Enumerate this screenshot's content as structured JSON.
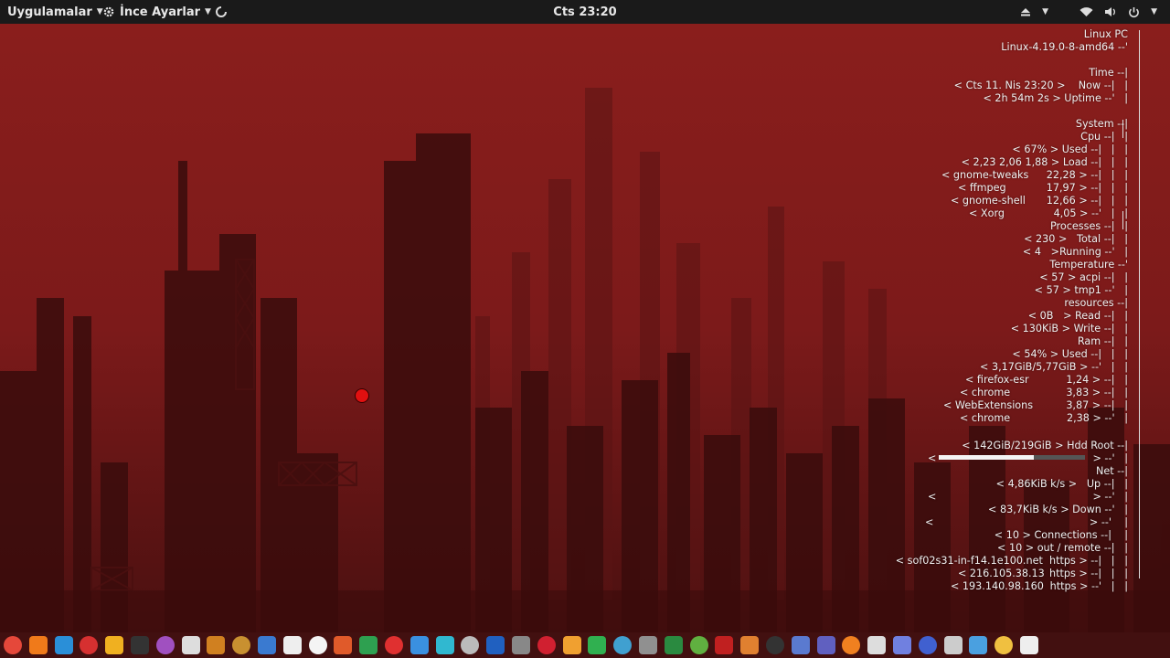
{
  "topbar": {
    "apps_label": "Uygulamalar",
    "tweaks_label": "İnce Ayarlar",
    "clock": "Cts 23:20"
  },
  "conky": {
    "host": "Linux PC",
    "kernel": "Linux-4.19.0-8-amd64",
    "time_header": "Time",
    "now_value": "< Cts 11. Nis 23:20 >",
    "now_label": "Now",
    "uptime_value": "< 2h 54m 2s >",
    "uptime_label": "Uptime",
    "system_header": "System",
    "cpu_header": "Cpu",
    "cpu_used_value": "< 67% >",
    "cpu_used_label": "Used",
    "load_value": "< 2,23 2,06 1,88 >",
    "load_label": "Load",
    "cpu_top": [
      {
        "name": "< gnome-tweaks",
        "value": "22,28 >"
      },
      {
        "name": "< ffmpeg",
        "value": "17,97 >"
      },
      {
        "name": "< gnome-shell",
        "value": "12,66 >"
      },
      {
        "name": "< Xorg",
        "value": "4,05 >"
      }
    ],
    "processes_header": "Processes",
    "total_value": "< 230 >",
    "total_label": "Total",
    "running_value": "< 4   >",
    "running_label": "Running",
    "temperature_header": "Temperature",
    "acpi_value": "< 57 >",
    "acpi_label": "acpi",
    "tmp1_value": "< 57 >",
    "tmp1_label": "tmp1",
    "resources_header": "resources",
    "read_value": "< 0B   >",
    "read_label": "Read",
    "write_value": "< 130KiB >",
    "write_label": "Write",
    "ram_header": "Ram",
    "ram_used_value": "< 54% >",
    "ram_used_label": "Used",
    "ram_amount": "< 3,17GiB/5,77GiB >",
    "mem_top": [
      {
        "name": "< firefox-esr",
        "value": "1,24 >"
      },
      {
        "name": "< chrome",
        "value": "3,83 >"
      },
      {
        "name": "< WebExtensions",
        "value": "3,87 >"
      },
      {
        "name": "< chrome",
        "value": "2,38 >"
      }
    ],
    "hdd_value": "< 142GiB/219GiB >",
    "hdd_label": "Hdd Root",
    "hdd_fraction": 0.65,
    "net_header": "Net",
    "up_value": "< 4,86KiB k/s >",
    "up_label": "Up",
    "down_value": "< 83,7KiB k/s >",
    "down_label": "Down",
    "connections_value": "< 10 >",
    "connections_label": "Connections",
    "outremote_value": "< 10 >",
    "outremote_label": "out / remote",
    "remotes": [
      {
        "host": "< sof02s31-in-f14.1e100.net",
        "port": "https >"
      },
      {
        "host": "< 216.105.38.13",
        "port": "https >"
      },
      {
        "host": "< 193.140.98.160",
        "port": "https >"
      }
    ]
  },
  "dock": {
    "icons": [
      "chrome-icon",
      "firefox-icon",
      "browser-icon",
      "opera-icon",
      "files-icon",
      "terminal-icon",
      "media-player-icon",
      "soccer-icon",
      "cleaner-icon",
      "broom-icon",
      "display-icon",
      "document-icon",
      "text-editor-icon",
      "presentation-icon",
      "spreadsheet-icon",
      "text-t-icon",
      "chromium-icon",
      "play-store-icon",
      "grid-app-icon",
      "calculator-icon",
      "settings-icon",
      "ad-blocker-icon",
      "pinwheel-icon",
      "spotify-icon",
      "screenshot-icon",
      "disk-icon",
      "system-monitor-icon",
      "archive-icon",
      "recorder-icon",
      "paint-icon",
      "steam-icon",
      "screen-icon",
      "teams-icon",
      "vlc-icon",
      "bluetooth-icon",
      "discord-icon",
      "activity-monitor-icon",
      "trash-icon",
      "window-icon",
      "weather-icon",
      "clock-icon"
    ],
    "colors": [
      "#e5483a",
      "#f07a1a",
      "#2a8fd8",
      "#d63030",
      "#f0b020",
      "#333333",
      "#a050c0",
      "#dddddd",
      "#d08020",
      "#c89030",
      "#3a7ad0",
      "#eeeeee",
      "#f4f4f4",
      "#e05a2a",
      "#2ea050",
      "#e03030",
      "#3a90e0",
      "#30b8d0",
      "#bbbbbb",
      "#2060c0",
      "#888888",
      "#d02030",
      "#f0a030",
      "#30b050",
      "#40a0d0",
      "#909090",
      "#2a8a40",
      "#60b040",
      "#c02020",
      "#e08030",
      "#333333",
      "#5a7ad0",
      "#6060c0",
      "#f08020",
      "#dddddd",
      "#7080e0",
      "#4060d0",
      "#cccccc",
      "#4aa0e0",
      "#f0c040",
      "#eeeeee"
    ]
  }
}
